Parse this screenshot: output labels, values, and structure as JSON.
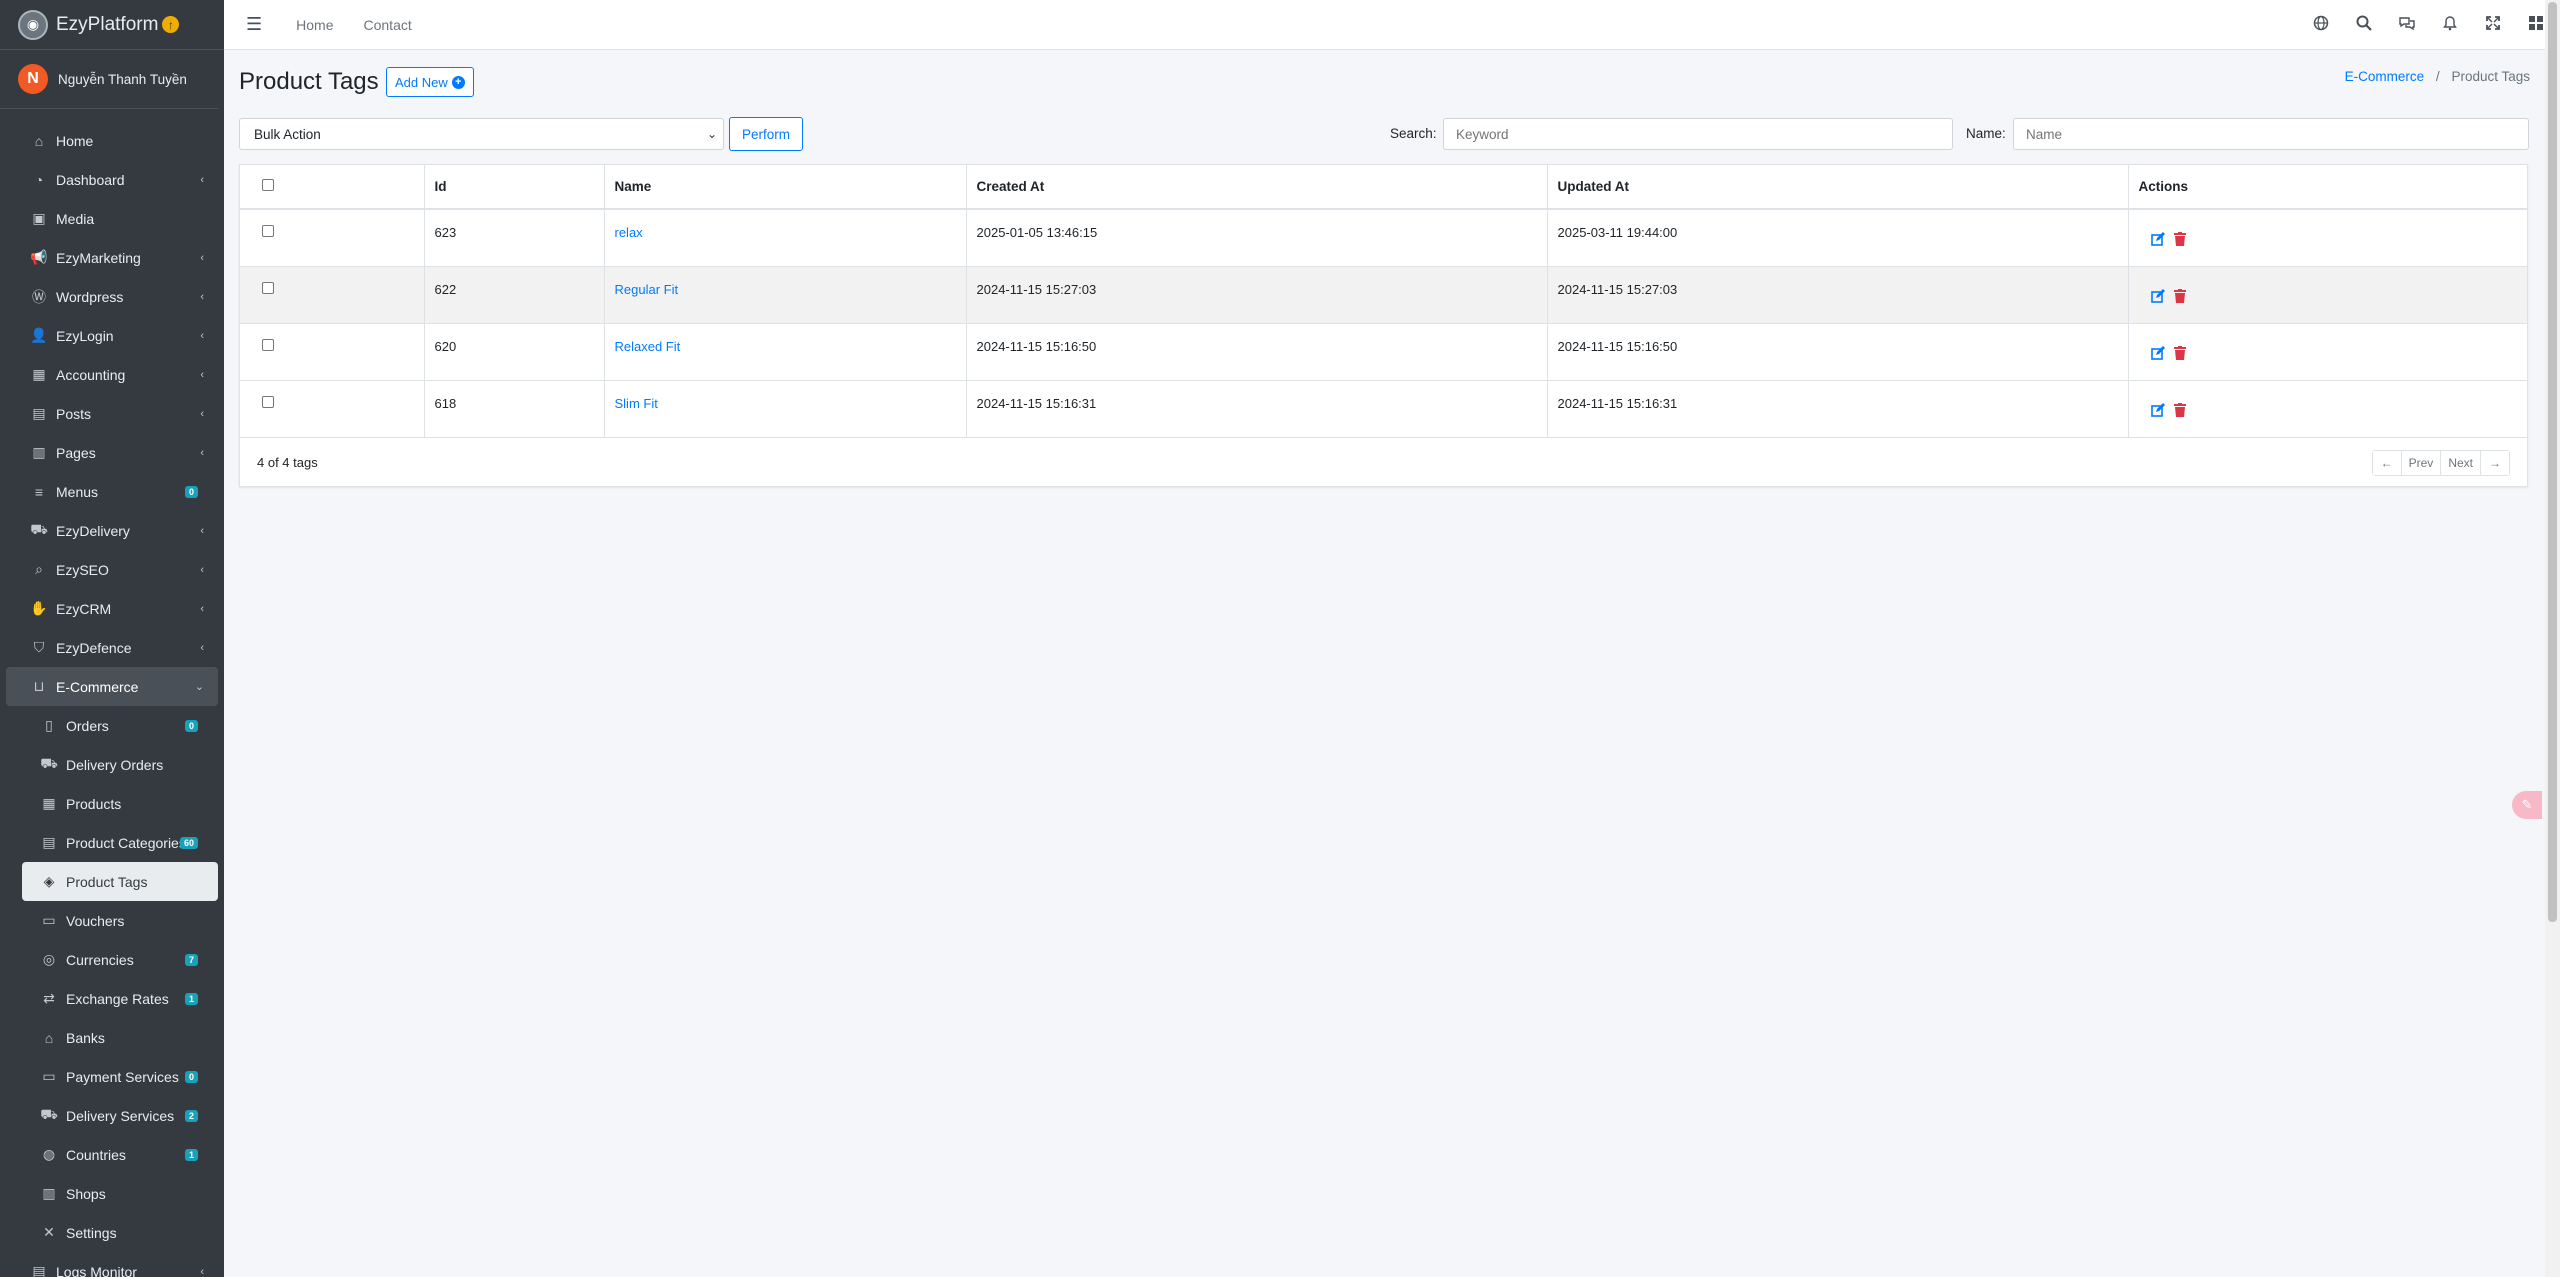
{
  "brand": {
    "name": "EzyPlatform",
    "upgrade_icon": "arrow-up-circle-icon"
  },
  "user": {
    "initial": "N",
    "name": "Nguyễn Thanh Tuyền"
  },
  "sidebar": {
    "items": [
      {
        "label": "Home",
        "icon": "home-icon"
      },
      {
        "label": "Dashboard",
        "icon": "dashboard-icon",
        "chevron": true
      },
      {
        "label": "Media",
        "icon": "image-icon"
      },
      {
        "label": "EzyMarketing",
        "icon": "megaphone-icon",
        "chevron": true
      },
      {
        "label": "Wordpress",
        "icon": "wordpress-icon",
        "chevron": true
      },
      {
        "label": "EzyLogin",
        "icon": "user-lock-icon",
        "chevron": true
      },
      {
        "label": "Accounting",
        "icon": "calculator-icon",
        "chevron": true
      },
      {
        "label": "Posts",
        "icon": "posts-icon",
        "chevron": true
      },
      {
        "label": "Pages",
        "icon": "pages-icon",
        "chevron": true
      },
      {
        "label": "Menus",
        "icon": "bars-icon",
        "badge": "0"
      },
      {
        "label": "EzyDelivery",
        "icon": "truck-icon",
        "chevron": true
      },
      {
        "label": "EzySEO",
        "icon": "search-plus-icon",
        "chevron": true
      },
      {
        "label": "EzyCRM",
        "icon": "handshake-icon",
        "chevron": true
      },
      {
        "label": "EzyDefence",
        "icon": "shield-icon",
        "chevron": true
      }
    ],
    "ecommerce": {
      "label": "E-Commerce",
      "icon": "basket-icon"
    },
    "sub_items": [
      {
        "label": "Orders",
        "icon": "receipt-icon",
        "badge": "0"
      },
      {
        "label": "Delivery Orders",
        "icon": "truck-loading-icon"
      },
      {
        "label": "Products",
        "icon": "boxes-icon"
      },
      {
        "label": "Product Categories",
        "icon": "clipboard-list-icon",
        "badge": "60"
      },
      {
        "label": "Product Tags",
        "icon": "tags-icon",
        "active": true
      },
      {
        "label": "Vouchers",
        "icon": "voucher-icon"
      },
      {
        "label": "Currencies",
        "icon": "coins-icon",
        "badge": "7"
      },
      {
        "label": "Exchange Rates",
        "icon": "exchange-icon",
        "badge": "1"
      },
      {
        "label": "Banks",
        "icon": "bank-icon"
      },
      {
        "label": "Payment Services",
        "icon": "payment-icon",
        "badge": "0"
      },
      {
        "label": "Delivery Services",
        "icon": "delivery-truck-icon",
        "badge": "2"
      },
      {
        "label": "Countries",
        "icon": "globe-icon",
        "badge": "1"
      },
      {
        "label": "Shops",
        "icon": "store-icon"
      },
      {
        "label": "Settings",
        "icon": "tools-icon"
      }
    ],
    "logs": {
      "label": "Logs Monitor",
      "icon": "logs-icon"
    }
  },
  "topbar": {
    "links": [
      "Home",
      "Contact"
    ]
  },
  "page": {
    "title": "Product Tags",
    "add_new": "Add New",
    "breadcrumb": {
      "parent": "E-Commerce",
      "current": "Product Tags"
    },
    "bulk_action": "Bulk Action",
    "perform": "Perform",
    "search_label": "Search:",
    "search_placeholder": "Keyword",
    "name_label": "Name:",
    "name_placeholder": "Name"
  },
  "table": {
    "headers": [
      "Id",
      "Name",
      "Created At",
      "Updated At",
      "Actions"
    ],
    "rows": [
      {
        "id": "623",
        "name": "relax",
        "created": "2025-01-05 13:46:15",
        "updated": "2025-03-11 19:44:00"
      },
      {
        "id": "622",
        "name": "Regular Fit",
        "created": "2024-11-15 15:27:03",
        "updated": "2024-11-15 15:27:03"
      },
      {
        "id": "620",
        "name": "Relaxed Fit",
        "created": "2024-11-15 15:16:50",
        "updated": "2024-11-15 15:16:50"
      },
      {
        "id": "618",
        "name": "Slim Fit",
        "created": "2024-11-15 15:16:31",
        "updated": "2024-11-15 15:16:31"
      }
    ],
    "count_text": "4 of 4 tags",
    "prev": "Prev",
    "next": "Next"
  },
  "colors": {
    "sidebar": "#343a40",
    "accent": "#007bff",
    "badge": "#17a2b8",
    "danger": "#dc3545"
  }
}
